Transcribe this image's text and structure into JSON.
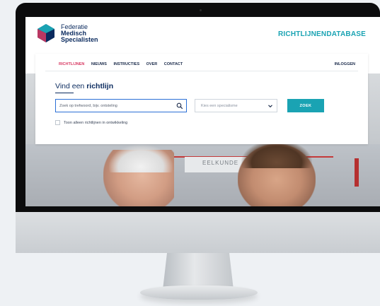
{
  "header": {
    "logo_line1": "Federatie",
    "logo_line2": "Medisch",
    "logo_line3": "Specialisten",
    "db_title": "RICHTLIJNENDATABASE"
  },
  "nav": {
    "items": [
      "RICHTLIJNEN",
      "NIEUWS",
      "INSTRUCTIES",
      "OVER",
      "CONTACT"
    ],
    "active_index": 0,
    "login": "INLOGGEN"
  },
  "search": {
    "title_prefix": "Vind een ",
    "title_bold": "richtlijn",
    "placeholder": "Zoek op trefwoord, bijv. ontsteling",
    "select_placeholder": "Kies een specialisme",
    "button_label": "ZOEK",
    "checkbox_label": "Toon alleen richtlijnen in ontwikkeling"
  },
  "hero": {
    "sign_text": "EELKUNDE"
  },
  "colors": {
    "accent": "#1aa3b3",
    "navy": "#0a2a5e",
    "active_nav": "#d83a63",
    "focus_border": "#2a6fd6"
  }
}
